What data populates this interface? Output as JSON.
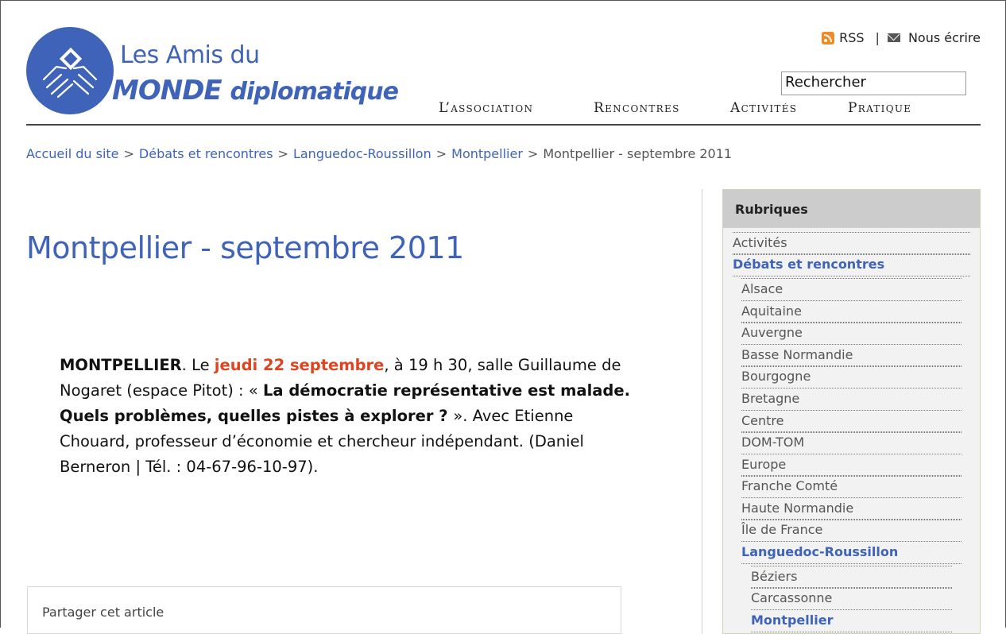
{
  "site": {
    "logo_line1": "Les Amis du",
    "logo_line2_main": "MONDE",
    "logo_line2_sub": "diplomatique"
  },
  "topbar": {
    "rss_label": "RSS",
    "separator": "|",
    "contact_label": "Nous écrire"
  },
  "search": {
    "value": "Rechercher"
  },
  "nav": [
    {
      "label": "L’association"
    },
    {
      "label": "Rencontres"
    },
    {
      "label": "Activités"
    },
    {
      "label": "Pratique"
    }
  ],
  "breadcrumb": {
    "items": [
      "Accueil du site",
      "Débats et rencontres",
      "Languedoc-Roussillon",
      "Montpellier"
    ],
    "separator": ">",
    "current": "Montpellier - septembre 2011"
  },
  "page": {
    "title": "Montpellier - septembre 2011",
    "article": {
      "place": "MONTPELLIER",
      "t1": ". Le ",
      "date": "jeudi 22 septembre",
      "t2": ", à 19 h 30, salle Guillaume de Nogaret (espace Pitot) : « ",
      "topic": "La démocratie représentative est malade. Quels problèmes, quelles pistes à explorer ? ",
      "t3": " ». Avec Etienne Chouard, professeur d’économie et chercheur indépendant. (Daniel Berneron | Tél. : 04-67-96-10-97)."
    },
    "share_label": "Partager cet article"
  },
  "sidebar": {
    "heading": "Rubriques",
    "items": [
      {
        "label": "Activités",
        "level": 0,
        "active": false
      },
      {
        "label": "Débats et rencontres",
        "level": 0,
        "active": true
      },
      {
        "label": "Alsace",
        "level": 1,
        "active": false
      },
      {
        "label": "Aquitaine",
        "level": 1,
        "active": false
      },
      {
        "label": "Auvergne",
        "level": 1,
        "active": false
      },
      {
        "label": "Basse Normandie",
        "level": 1,
        "active": false
      },
      {
        "label": "Bourgogne",
        "level": 1,
        "active": false
      },
      {
        "label": "Bretagne",
        "level": 1,
        "active": false
      },
      {
        "label": "Centre",
        "level": 1,
        "active": false
      },
      {
        "label": "DOM-TOM",
        "level": 1,
        "active": false
      },
      {
        "label": "Europe",
        "level": 1,
        "active": false
      },
      {
        "label": "Franche Comté",
        "level": 1,
        "active": false
      },
      {
        "label": "Haute Normandie",
        "level": 1,
        "active": false
      },
      {
        "label": "Île de France",
        "level": 1,
        "active": false
      },
      {
        "label": "Languedoc-Roussillon",
        "level": 1,
        "active": true
      },
      {
        "label": "Béziers",
        "level": 2,
        "active": false
      },
      {
        "label": "Carcassonne",
        "level": 2,
        "active": false
      },
      {
        "label": "Montpellier",
        "level": 2,
        "active": true
      }
    ]
  },
  "colors": {
    "link": "#3e63b8",
    "accent_date": "#e0431f",
    "sidebar_bg": "#f2f2f2",
    "sidebar_head": "#cccccc"
  }
}
